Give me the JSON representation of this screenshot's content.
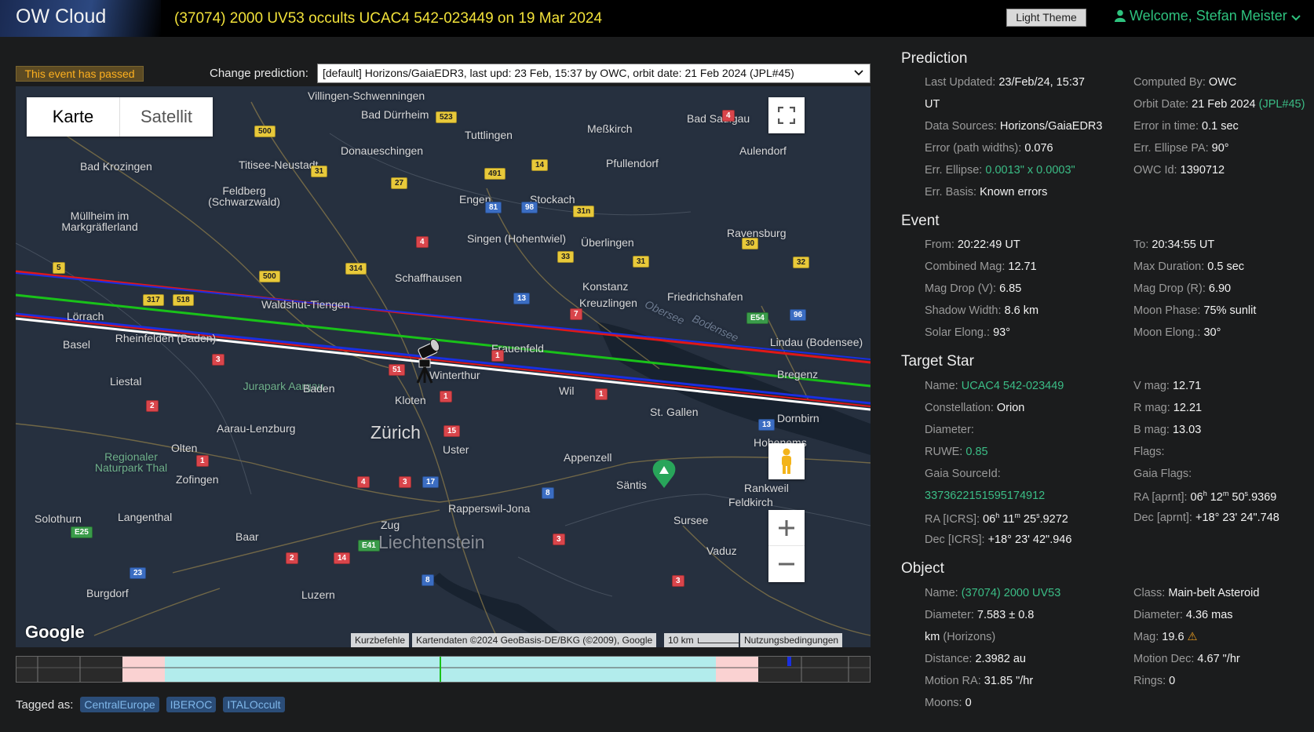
{
  "header": {
    "logo": "OW Cloud",
    "event_title": "(37074) 2000 UV53 occults UCAC4 542-023449 on 19 Mar 2024",
    "theme_button": "Light Theme",
    "welcome": "Welcome, Stefan Meister"
  },
  "status_badge": "This event has passed",
  "prediction_select": {
    "label": "Change prediction:",
    "value": "[default] Horizons/GaiaEDR3, last upd: 23 Feb, 15:37 by OWC, orbit date: 21 Feb 2024 (JPL#45)"
  },
  "map": {
    "type_karte": "Karte",
    "type_satellit": "Satellit",
    "attribution_shortcuts": "Kurzbefehle",
    "attribution_data": "Kartendaten ©2024 GeoBasis-DE/BKG (©2009), Google",
    "scale": "10 km",
    "terms": "Nutzungsbedingungen",
    "google": "Google",
    "places": [
      "Villingen-Schwenningen",
      "Bad Dürrheim",
      "Tuttlingen",
      "Meßkirch",
      "Bad Saulgau",
      "Donaueschingen",
      "Titisee-Neustadt",
      "Pfullendorf",
      "Aulendorf",
      "Bad Krozingen",
      "Feldberg (Schwarzwald)",
      "Engen",
      "Stockach",
      "Müllheim im Markgräflerland",
      "Singen (Hohentwiel)",
      "Überlingen",
      "Ravensburg",
      "Schaffhausen",
      "Konstanz",
      "Friedrichshafen",
      "Kreuzlingen",
      "Lörrach",
      "Waldshut-Tiengen",
      "Rheinfelden (Baden)",
      "Basel",
      "Frauenfeld",
      "Lindau (Bodensee)",
      "Bregenz",
      "Winterthur",
      "Liestal",
      "Jurapark Aargau",
      "Baden",
      "Kloten",
      "Wil",
      "St. Gallen",
      "Dornbirn",
      "Zürich",
      "Uster",
      "Hohenems",
      "Aarau-Lenzburg",
      "Olten",
      "Appenzell",
      "Regionaler Naturpark Thal",
      "Zofingen",
      "Säntis",
      "Rankweil",
      "Feldkirch",
      "Rapperswil-Jona",
      "Solothurn",
      "Langenthal",
      "Baar",
      "Zug",
      "Liechtenstein",
      "Sursee",
      "Vaduz",
      "Burgdorf",
      "Luzern",
      "Obersee",
      "Bodensee"
    ],
    "road_numbers": [
      "500",
      "523",
      "31",
      "491",
      "14",
      "27",
      "81",
      "98",
      "31n",
      "4",
      "33",
      "31",
      "314",
      "500",
      "5",
      "317",
      "518",
      "13",
      "7",
      "E54",
      "96",
      "1",
      "3",
      "51",
      "1",
      "1",
      "2",
      "15",
      "13",
      "1",
      "17",
      "4",
      "3",
      "8",
      "E25",
      "E41",
      "14",
      "2",
      "3",
      "23",
      "8",
      "3",
      "32",
      "30",
      "4"
    ]
  },
  "tagged": {
    "label": "Tagged as:",
    "tags": [
      "CentralEurope",
      "IBEROC",
      "ITALOccult"
    ]
  },
  "prediction": {
    "title": "Prediction",
    "last_updated_label": "Last Updated:",
    "last_updated": "23/Feb/24, 15:37",
    "last_updated_unit": "UT",
    "computed_by_label": "Computed By:",
    "computed_by": "OWC",
    "orbit_date_label": "Orbit Date:",
    "orbit_date": "21 Feb 2024",
    "orbit_jpl": "(JPL#45)",
    "data_sources_label": "Data Sources:",
    "data_sources": "Horizons/GaiaEDR3",
    "error_time_label": "Error in time:",
    "error_time": "0.1 sec",
    "error_path_label": "Error (path widths):",
    "error_path": "0.076",
    "err_pa_label": "Err. Ellipse PA:",
    "err_pa": "90°",
    "err_ellipse_label": "Err. Ellipse:",
    "err_ellipse": "0.0013\" x 0.0003\"",
    "owc_id_label": "OWC Id:",
    "owc_id": "1390712",
    "err_basis_label": "Err. Basis:",
    "err_basis": "Known errors"
  },
  "event": {
    "title": "Event",
    "from_label": "From:",
    "from": "20:22:49 UT",
    "to_label": "To:",
    "to": "20:34:55 UT",
    "combined_mag_label": "Combined Mag:",
    "combined_mag": "12.71",
    "max_duration_label": "Max Duration:",
    "max_duration": "0.5 sec",
    "mag_drop_v_label": "Mag Drop (V):",
    "mag_drop_v": "6.85",
    "mag_drop_r_label": "Mag Drop (R):",
    "mag_drop_r": "6.90",
    "shadow_width_label": "Shadow Width:",
    "shadow_width": "8.6 km",
    "moon_phase_label": "Moon Phase:",
    "moon_phase": "75% sunlit",
    "solar_elong_label": "Solar Elong.:",
    "solar_elong": "93°",
    "moon_elong_label": "Moon Elong.:",
    "moon_elong": "30°"
  },
  "target_star": {
    "title": "Target Star",
    "name_label": "Name:",
    "name": "UCAC4 542-023449",
    "vmag_label": "V mag:",
    "vmag": "12.71",
    "constellation_label": "Constellation:",
    "constellation": "Orion",
    "rmag_label": "R mag:",
    "rmag": "12.21",
    "diameter_label": "Diameter:",
    "bmag_label": "B mag:",
    "bmag": "13.03",
    "ruwe_label": "RUWE:",
    "ruwe": "0.85",
    "flags_label": "Flags:",
    "gaia_source_label": "Gaia SourceId:",
    "gaia_source": "3373622151595174912",
    "gaia_flags_label": "Gaia Flags:",
    "ra_icrs_label": "RA [ICRS]:",
    "ra_icrs_h": "06",
    "ra_icrs_m": "11",
    "ra_icrs_s": "25",
    "ra_icrs_frac": ".9272",
    "ra_aprnt_label": "RA [aprnt]:",
    "ra_aprnt_h": "06",
    "ra_aprnt_m": "12",
    "ra_aprnt_s": "50",
    "ra_aprnt_frac": ".9369",
    "dec_icrs_label": "Dec [ICRS]:",
    "dec_icrs": "+18° 23' 42\".946",
    "dec_aprnt_label": "Dec [aprnt]:",
    "dec_aprnt": "+18° 23' 24\".748"
  },
  "object": {
    "title": "Object",
    "name_label": "Name:",
    "name": "(37074) 2000 UV53",
    "class_label": "Class:",
    "class": "Main-belt Asteroid",
    "diameter_label": "Diameter:",
    "diameter": "7.583 ± 0.8",
    "diameter_unit": "km",
    "diameter_source": "(Horizons)",
    "ang_diameter_label": "Diameter:",
    "ang_diameter": "4.36 mas",
    "mag_label": "Mag:",
    "mag": "19.6",
    "distance_label": "Distance:",
    "distance": "2.3982 au",
    "motion_dec_label": "Motion Dec:",
    "motion_dec": "4.67 \"/hr",
    "motion_ra_label": "Motion RA:",
    "motion_ra": "31.85 \"/hr",
    "rings_label": "Rings:",
    "rings": "0",
    "moons_label": "Moons:",
    "moons": "0"
  },
  "colors": {
    "accent_green": "#3bbd86",
    "title_yellow": "#f2e23a",
    "path_red": "#e01818",
    "path_green": "#19c219",
    "path_blue": "#1a2fe0",
    "path_white": "#ffffff"
  }
}
